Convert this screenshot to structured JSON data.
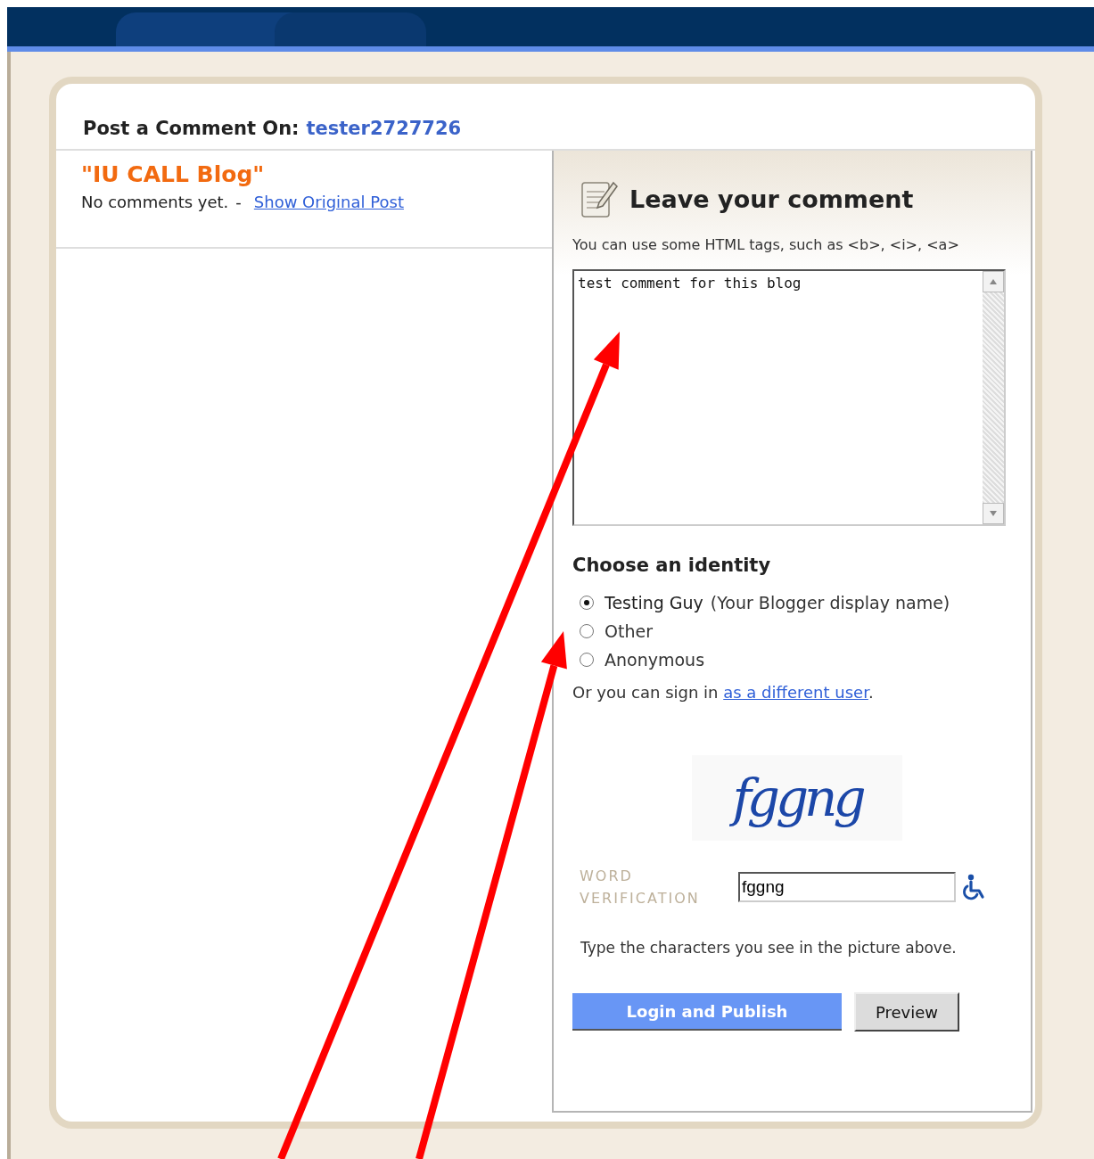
{
  "header": {
    "label": "Post a Comment On:",
    "blog_link": "tester2727726"
  },
  "post": {
    "title": "\"IU CALL Blog\"",
    "status": "No comments yet.",
    "separator": "-",
    "link": "Show Original Post"
  },
  "comment_form": {
    "title": "Leave your comment",
    "note": "You can use some HTML tags, such as <b>, <i>, <a>",
    "comment": "test comment for this blog"
  },
  "identity": {
    "title": "Choose an identity",
    "options": [
      {
        "label": "Testing Guy",
        "hint": "(Your Blogger display name)",
        "selected": true
      },
      {
        "label": "Other",
        "selected": false
      },
      {
        "label": "Anonymous",
        "selected": false
      }
    ],
    "sign_in_text": "Or you can sign in",
    "sign_in_link": "as a different user",
    "sign_in_end": "."
  },
  "verification": {
    "captcha": "fggng",
    "label_lines": [
      "WORD",
      "VERIFICATION"
    ],
    "value": "fggng",
    "hint": "Type the characters you see in the picture above."
  },
  "buttons": [
    {
      "label": "Login and Publish",
      "kind": "primary"
    },
    {
      "label": "Preview",
      "kind": "secondary"
    }
  ]
}
